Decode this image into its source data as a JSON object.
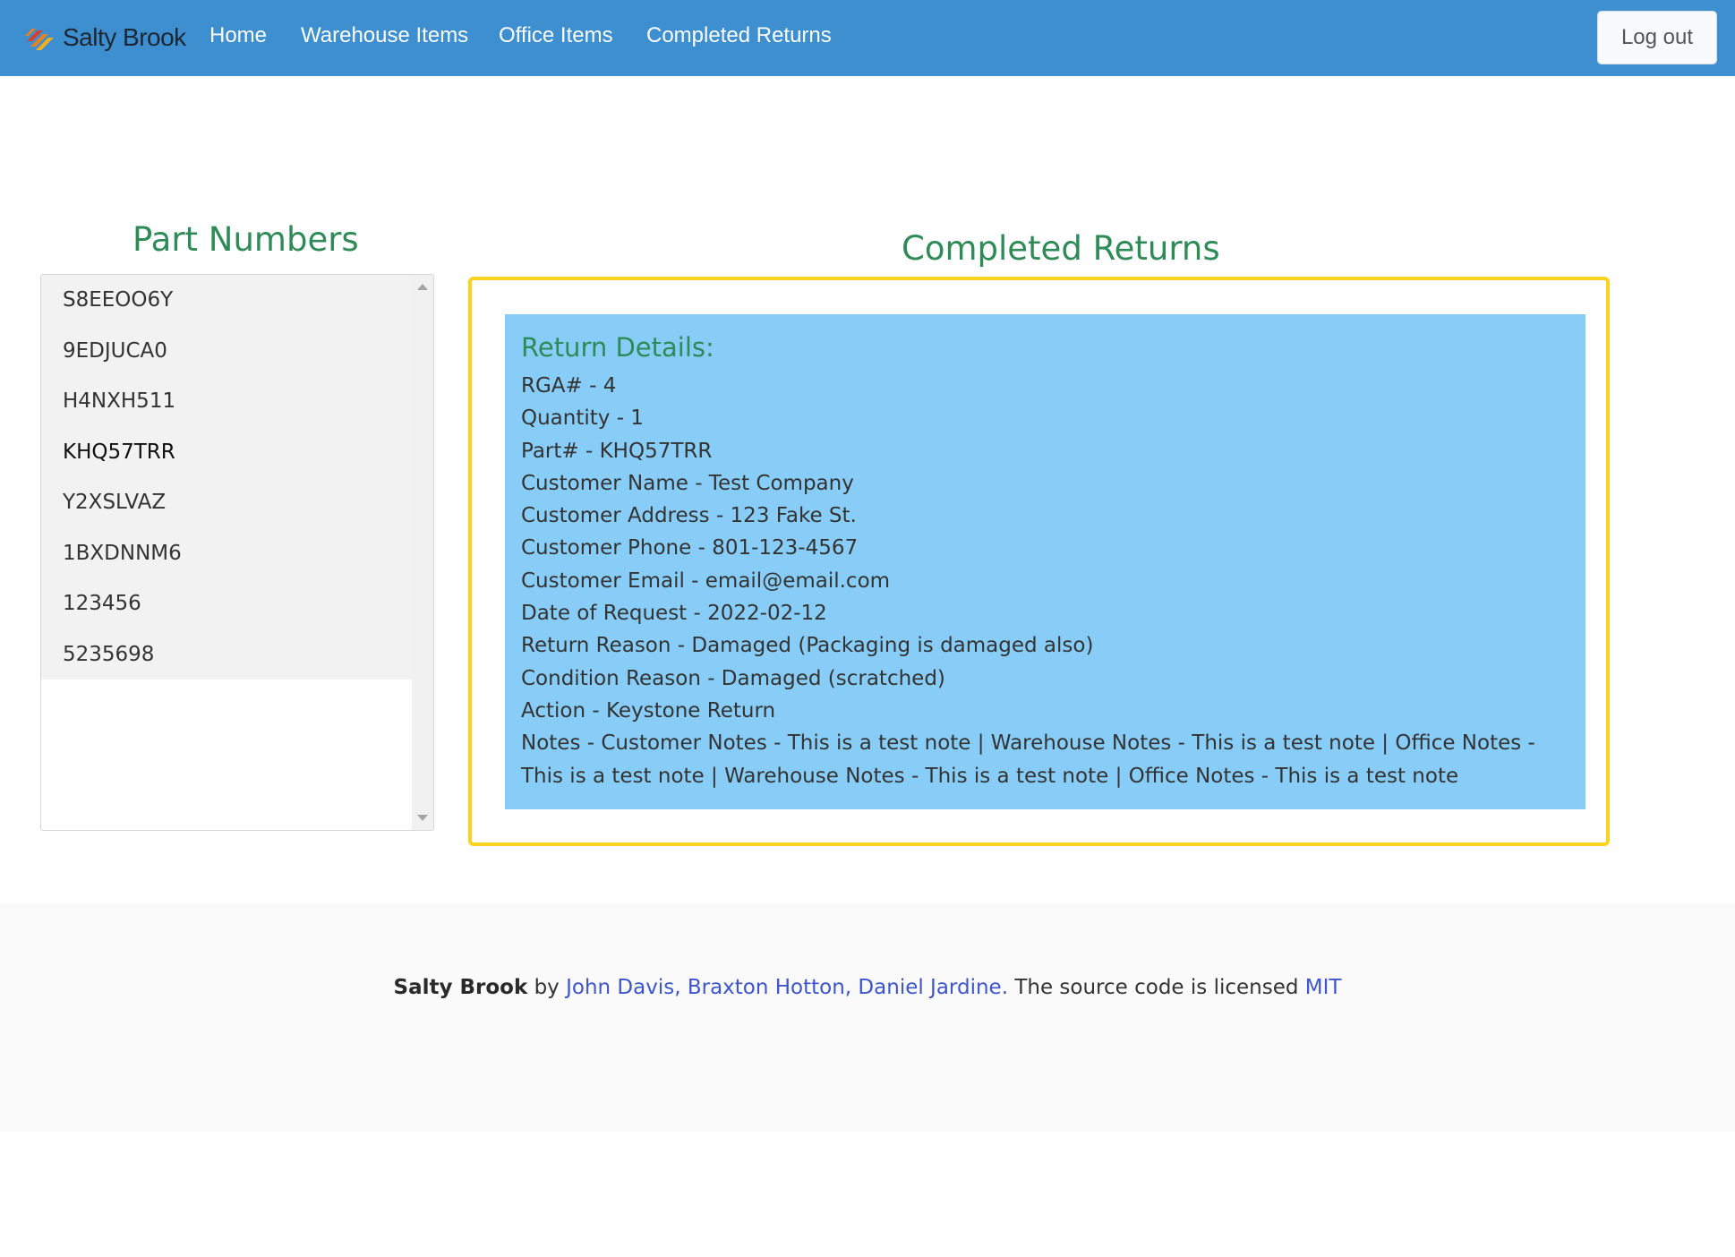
{
  "navbar": {
    "brand": "Salty Brook",
    "links": [
      "Home",
      "Warehouse Items",
      "Office Items",
      "Completed Returns"
    ],
    "logout_label": "Log out",
    "colors": {
      "background": "#3d8fd0",
      "logo_orange": "#e8821e",
      "logo_red": "#d6402a",
      "logo_yellow": "#f3b01a"
    }
  },
  "parts": {
    "title": "Part Numbers",
    "items": [
      "S8EEOO6Y",
      "9EDJUCA0",
      "H4NXH511",
      "KHQ57TRR",
      "Y2XSLVAZ",
      "1BXDNNM6",
      "123456",
      "5235698"
    ],
    "selected": "KHQ57TRR"
  },
  "returns": {
    "title": "Completed Returns",
    "heading": "Return Details:",
    "lines": [
      "RGA# - 4",
      "Quantity - 1",
      "Part# - KHQ57TRR",
      "Customer Name - Test Company",
      "Customer Address - 123 Fake St.",
      "Customer Phone - 801-123-4567",
      "Customer Email - email@email.com",
      "Date of Request - 2022-02-12",
      "Return Reason - Damaged (Packaging is damaged also)",
      "Condition Reason - Damaged (scratched)",
      "Action - Keystone Return",
      "Notes - Customer Notes - This is a test note | Warehouse Notes - This is a test note | Office Notes - This is a test note | Warehouse Notes - This is a test note | Office Notes - This is a test note"
    ],
    "colors": {
      "frame": "#fcd21c",
      "panel": "#87cdf8",
      "heading": "#2e8b57"
    }
  },
  "footer": {
    "brand": "Salty Brook",
    "by": "by",
    "authors": "John Davis, Braxton Hotton, Daniel Jardine.",
    "license_text": "The source code is licensed",
    "license_link": "MIT"
  }
}
